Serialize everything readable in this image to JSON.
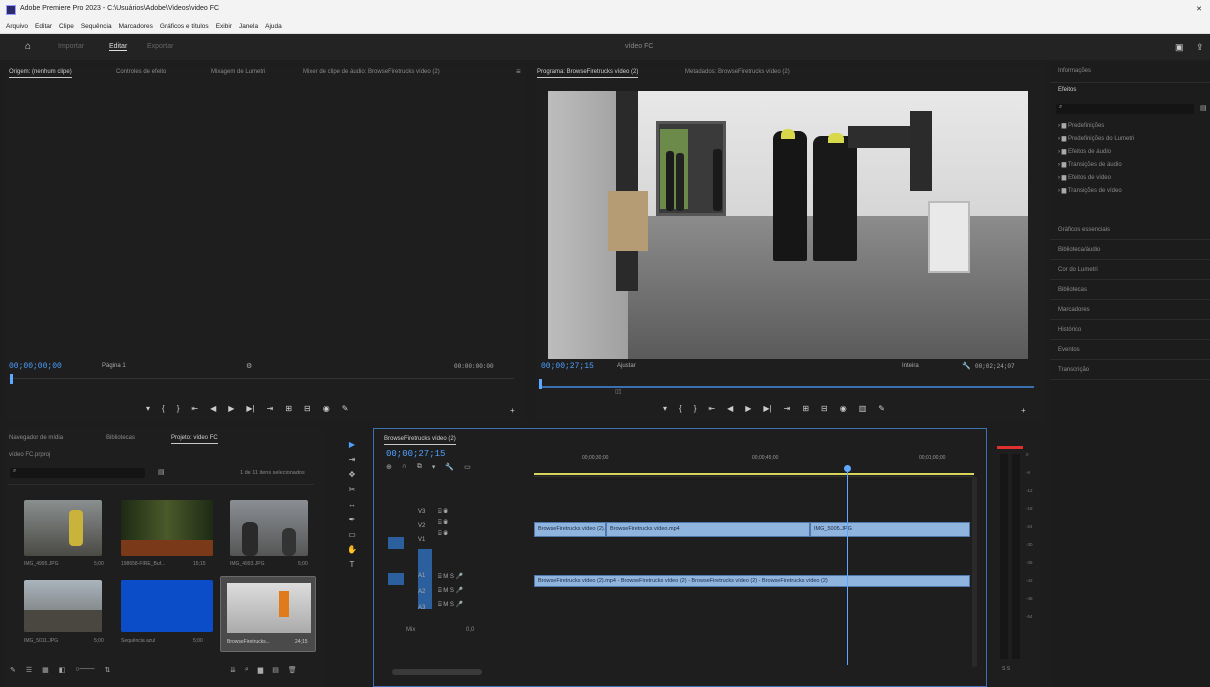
{
  "window": {
    "title": "Adobe Premiere Pro 2023 - C:\\Usuários\\Adobe\\Videos\\video FC"
  },
  "menu": [
    "Arquivo",
    "Editar",
    "Clipe",
    "Sequência",
    "Marcadores",
    "Gráficos e títulos",
    "Exibir",
    "Janela",
    "Ajuda"
  ],
  "workspace": {
    "tabs": [
      "Importar",
      "Editar",
      "Exportar"
    ],
    "project_name": "vídeo FC"
  },
  "source_monitor": {
    "tabs": [
      "Origem: (nenhum clipe)",
      "Controles de efeito",
      "Mixagem de Lumetri",
      "Mixer de clipe de áudio: BrowseFiretrucks vídeo (2)"
    ],
    "timecode_left": "00;00;00;00",
    "page_label": "Página 1",
    "timecode_right": "00:00:00:00"
  },
  "program_monitor": {
    "tabs": [
      "Programa: BrowseFiretrucks vídeo (2)",
      "Metadados: BrowseFiretrucks vídeo (2)"
    ],
    "timecode": "00;00;27;15",
    "fit": "Ajustar",
    "quality": "Inteira",
    "duration": "00;02;24;07"
  },
  "effects_panel": {
    "header": "Informações",
    "title": "Efeitos",
    "search_placeholder": "",
    "items": [
      "Predefinições",
      "Predefinições do Lumetri",
      "Efeitos de áudio",
      "Transições de áudio",
      "Efeitos de vídeo",
      "Transições de vídeo"
    ],
    "sections": [
      "Gráficos essenciais",
      "Biblioteca/áudio",
      "Cor do Lumetri",
      "Bibliotecas",
      "Marcadores",
      "Histórico",
      "Eventos",
      "Transcrição"
    ]
  },
  "project_panel": {
    "tabs": [
      "Navegador de mídia",
      "Bibliotecas",
      "Projeto: vídeo FC"
    ],
    "project_file": "vídeo FC.prproj",
    "item_count": "1 de 11 itens selecionados",
    "items": [
      {
        "name": "IMG_4995.JPG",
        "duration": "5;00"
      },
      {
        "name": "198658-FIRE_Buf...",
        "duration": "15;15"
      },
      {
        "name": "IMG_4993.JPG",
        "duration": "5;00"
      },
      {
        "name": "IMG_5011.JPG",
        "duration": "5;00"
      },
      {
        "name": "Sequência azul",
        "duration": "5;00"
      },
      {
        "name": "BrowseFiretrucks...",
        "duration": "24;15"
      }
    ]
  },
  "timeline": {
    "tab": "BrowseFiretrucks vídeo (2)",
    "timecode": "00;00;27;15",
    "ruler": [
      "00;00;30;00",
      "00;00;45;00",
      "00;01;00;00"
    ],
    "tracks_video": [
      "V3",
      "V2",
      "V1"
    ],
    "tracks_audio": [
      "A1",
      "A2",
      "A3"
    ],
    "mix_label": "Mix",
    "mix_value": "0,0",
    "clips_v1": [
      "BrowseFiretrucks vídeo (2).mp4",
      "BrowseFiretrucks vídeo.mp4",
      "IMG_5005.JPG"
    ],
    "clip_a1": "BrowseFiretrucks vídeo (2).mp4 - BrowseFiretrucks vídeo (2) - BrowseFiretrucks vídeo (2) - BrowseFiretrucks vídeo (2)"
  },
  "meter": {
    "labels": [
      "0",
      "-6",
      "-12",
      "-18",
      "-24",
      "-30",
      "-36",
      "-42",
      "-48",
      "-54"
    ],
    "footer": "S S"
  },
  "colors": {
    "accent": "#4ea0ff",
    "clip_blue": "#8fb4de",
    "playhead": "#5fa8ff",
    "work_area": "#d9d45a"
  }
}
